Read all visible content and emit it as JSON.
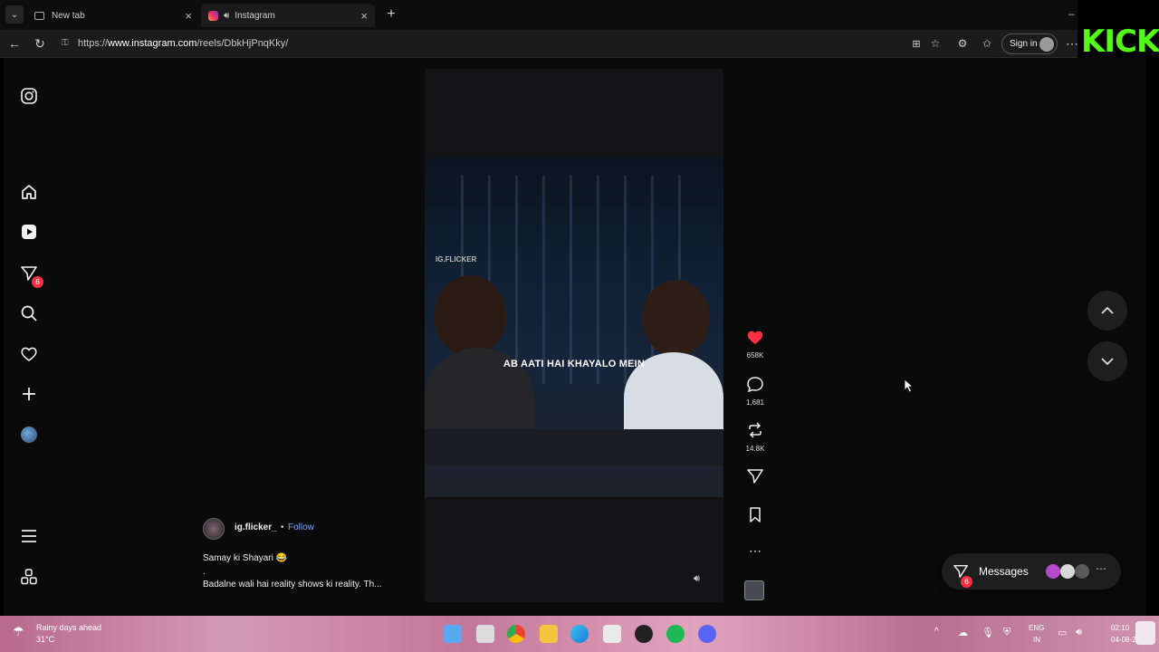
{
  "browser": {
    "tabs": [
      {
        "label": "New tab"
      },
      {
        "label": "Instagram"
      }
    ],
    "url": "https://www.instagram.com/reels/DbkHjPnqKky/",
    "sign_in_label": "Sign in",
    "overlay_logo": "KICK"
  },
  "sidebar": {
    "notification_count": "6"
  },
  "reel": {
    "watermark": "IG.FLICKER",
    "caption_overlay": "AB AATI HAI KHAYALO MEIN",
    "actions": {
      "likes": "658K",
      "comments": "1,681",
      "reposts": "14.8K"
    },
    "author": {
      "username": "ig.flicker_",
      "separator": "•",
      "follow_label": "Follow"
    },
    "caption_lines": [
      "Samay ki Shayari 😂",
      ".",
      "Badalne wali hai reality shows ki reality. Th..."
    ]
  },
  "messages": {
    "label": "Messages",
    "badge": "6"
  },
  "taskbar": {
    "weather_text": "Rainy days ahead",
    "temperature": "31°C",
    "language": "ENG",
    "region": "IN",
    "time": "02:10",
    "date": "04-08-2"
  },
  "colors": {
    "like_red": "#ff3040",
    "follow_blue": "#7aa7ff",
    "kick_green": "#53fc18"
  }
}
